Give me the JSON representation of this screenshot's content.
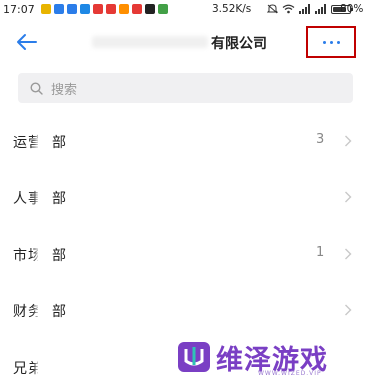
{
  "status_bar": {
    "time": "17:07",
    "speed": "3.52K/s",
    "battery_pct": "80%",
    "battery_level": 0.8,
    "notif_colors": [
      "#e8b400",
      "#2b7de9",
      "#2b7de9",
      "#1e88e5",
      "#e53935",
      "#e53935",
      "#ff8f00",
      "#e53935",
      "#222222",
      "#43a047"
    ]
  },
  "header": {
    "title": "有限公司",
    "back_icon": "arrow-left-icon",
    "more_icon": "more-dots-icon",
    "highlight_color": "#c00000",
    "accent_color": "#2b7de9"
  },
  "search": {
    "placeholder": "搜索"
  },
  "departments": [
    {
      "name_left": "运营",
      "name_right": "部",
      "count": "3"
    },
    {
      "name_left": "人事",
      "name_right": "部",
      "count": ""
    },
    {
      "name_left": "市场",
      "name_right": "部",
      "count": "1"
    },
    {
      "name_left": "财务",
      "name_right": "部",
      "count": ""
    },
    {
      "name_left": "兄弟",
      "name_right": "",
      "count": ""
    }
  ],
  "watermark": {
    "title": "维泽游戏",
    "url": "WWW.WIZED.VIP",
    "color": "#7a3fc4"
  }
}
